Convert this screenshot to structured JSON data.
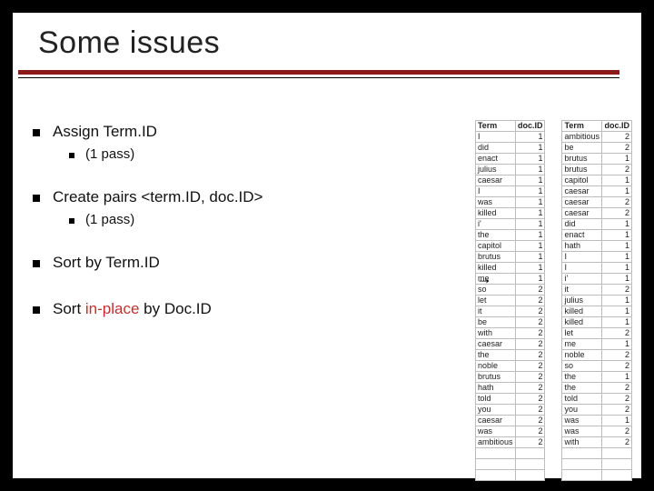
{
  "title": "Some issues",
  "bullets": {
    "b1": "Assign Term.ID",
    "b1a": "(1 pass)",
    "b2": "Create pairs <term.ID, doc.ID>",
    "b2a": "(1 pass)",
    "b3": "Sort by Term.ID",
    "b4_pre": "Sort ",
    "b4_accent": "in-place",
    "b4_post": " by Doc.ID"
  },
  "table_headers": {
    "term": "Term",
    "doc": "doc.ID"
  },
  "table_left": [
    [
      "I",
      1
    ],
    [
      "did",
      1
    ],
    [
      "enact",
      1
    ],
    [
      "julius",
      1
    ],
    [
      "caesar",
      1
    ],
    [
      "I",
      1
    ],
    [
      "was",
      1
    ],
    [
      "killed",
      1
    ],
    [
      "i'",
      1
    ],
    [
      "the",
      1
    ],
    [
      "capitol",
      1
    ],
    [
      "brutus",
      1
    ],
    [
      "killed",
      1
    ],
    [
      "me",
      1
    ],
    [
      "so",
      2
    ],
    [
      "let",
      2
    ],
    [
      "it",
      2
    ],
    [
      "be",
      2
    ],
    [
      "with",
      2
    ],
    [
      "caesar",
      2
    ],
    [
      "the",
      2
    ],
    [
      "noble",
      2
    ],
    [
      "brutus",
      2
    ],
    [
      "hath",
      2
    ],
    [
      "told",
      2
    ],
    [
      "you",
      2
    ],
    [
      "caesar",
      2
    ],
    [
      "was",
      2
    ],
    [
      "ambitious",
      2
    ]
  ],
  "table_right": [
    [
      "ambitious",
      2
    ],
    [
      "be",
      2
    ],
    [
      "brutus",
      1
    ],
    [
      "brutus",
      2
    ],
    [
      "capitol",
      1
    ],
    [
      "caesar",
      1
    ],
    [
      "caesar",
      2
    ],
    [
      "caesar",
      2
    ],
    [
      "did",
      1
    ],
    [
      "enact",
      1
    ],
    [
      "hath",
      1
    ],
    [
      "I",
      1
    ],
    [
      "I",
      1
    ],
    [
      "i'",
      1
    ],
    [
      "it",
      2
    ],
    [
      "julius",
      1
    ],
    [
      "killed",
      1
    ],
    [
      "killed",
      1
    ],
    [
      "let",
      2
    ],
    [
      "me",
      1
    ],
    [
      "noble",
      2
    ],
    [
      "so",
      2
    ],
    [
      "the",
      1
    ],
    [
      "the",
      2
    ],
    [
      "told",
      2
    ],
    [
      "you",
      2
    ],
    [
      "was",
      1
    ],
    [
      "was",
      2
    ],
    [
      "with",
      2
    ]
  ],
  "arrow_glyph": "→"
}
